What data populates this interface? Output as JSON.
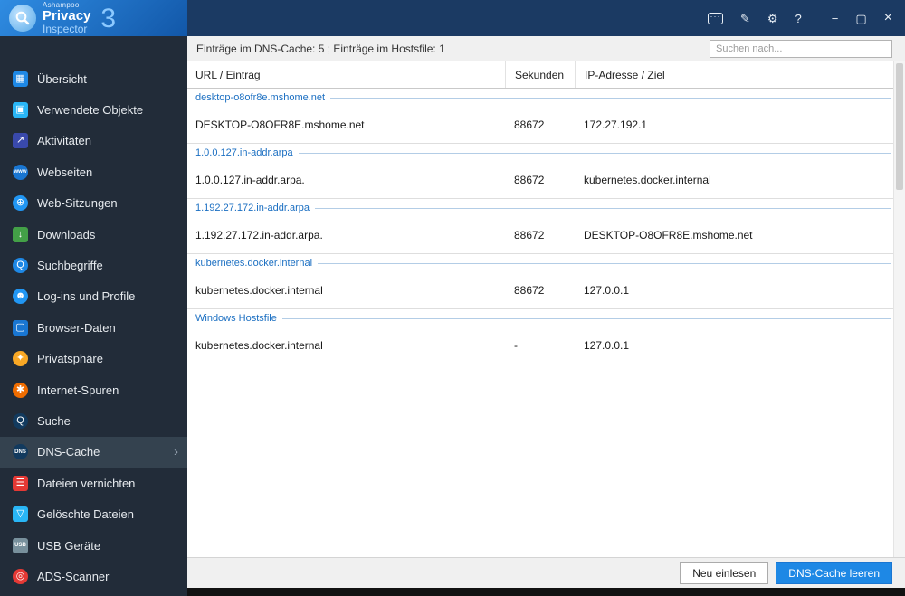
{
  "app": {
    "brand_small": "Ashampoo",
    "brand_line1": "Privacy",
    "brand_line2": "Inspector",
    "brand_version": "3"
  },
  "titlebar": {
    "icons": [
      {
        "name": "feedback-icon",
        "glyph": "···",
        "style": "bubble"
      },
      {
        "name": "survey-icon",
        "glyph": "✎"
      },
      {
        "name": "settings-icon",
        "glyph": "⚙"
      },
      {
        "name": "help-icon",
        "glyph": "?"
      },
      {
        "name": "minimize-icon",
        "glyph": "−",
        "win": true
      },
      {
        "name": "maximize-icon",
        "glyph": "▢",
        "win": false
      },
      {
        "name": "close-icon",
        "glyph": "×",
        "close": true
      }
    ]
  },
  "sidebar": {
    "items": [
      {
        "name": "uebersicht",
        "label": "Übersicht",
        "glyph": "▦",
        "bg": "#1e88e5",
        "shape": "square"
      },
      {
        "name": "verwendete-objekte",
        "label": "Verwendete Objekte",
        "glyph": "▣",
        "bg": "#29b6f6",
        "shape": "square"
      },
      {
        "name": "aktivitaeten",
        "label": "Aktivitäten",
        "glyph": "↗",
        "bg": "#3949ab",
        "shape": "square"
      },
      {
        "name": "webseiten",
        "label": "Webseiten",
        "glyph": "www",
        "bg": "#1976d2",
        "shape": "circle",
        "small": true
      },
      {
        "name": "web-sitzungen",
        "label": "Web-Sitzungen",
        "glyph": "⊕",
        "bg": "#2196f3",
        "shape": "circle"
      },
      {
        "name": "downloads",
        "label": "Downloads",
        "glyph": "↓",
        "bg": "#43a047",
        "shape": "square"
      },
      {
        "name": "suchbegriffe",
        "label": "Suchbegriffe",
        "glyph": "Q",
        "bg": "#1e88e5",
        "shape": "circle"
      },
      {
        "name": "logins-und-profile",
        "label": "Log-ins und Profile",
        "glyph": "☻",
        "bg": "#2196f3",
        "shape": "circle"
      },
      {
        "name": "browser-daten",
        "label": "Browser-Daten",
        "glyph": "▢",
        "bg": "#1976d2",
        "shape": "square"
      },
      {
        "name": "privatsphaere",
        "label": "Privatsphäre",
        "glyph": "✦",
        "bg": "#f9a825",
        "shape": "circle"
      },
      {
        "name": "internet-spuren",
        "label": "Internet-Spuren",
        "glyph": "✱",
        "bg": "#ef6c00",
        "shape": "circle"
      },
      {
        "name": "suche",
        "label": "Suche",
        "glyph": "Q",
        "bg": "#123a5e",
        "shape": "circle"
      },
      {
        "name": "dns-cache",
        "label": "DNS-Cache",
        "glyph": "DNS",
        "bg": "#123a5e",
        "shape": "circle",
        "small": true,
        "selected": true
      },
      {
        "name": "dateien-vernichten",
        "label": "Dateien vernichten",
        "glyph": "☰",
        "bg": "#e53935",
        "shape": "square"
      },
      {
        "name": "geloeschte-dateien",
        "label": "Gelöschte Dateien",
        "glyph": "▽",
        "bg": "#29b6f6",
        "shape": "square"
      },
      {
        "name": "usb-geraete",
        "label": "USB Geräte",
        "glyph": "USB",
        "bg": "#78909c",
        "shape": "square",
        "small": true
      },
      {
        "name": "ads-scanner",
        "label": "ADS-Scanner",
        "glyph": "◎",
        "bg": "#e53935",
        "shape": "circle"
      }
    ]
  },
  "main": {
    "status": "Einträge im DNS-Cache: 5 ; Einträge im Hostsfile: 1",
    "search_placeholder": "Suchen nach...",
    "table": {
      "columns": [
        "URL / Eintrag",
        "Sekunden",
        "IP-Adresse / Ziel"
      ],
      "groups": [
        {
          "header": "desktop-o8ofr8e.mshome.net",
          "rows": [
            [
              "DESKTOP-O8OFR8E.mshome.net",
              "88672",
              "172.27.192.1"
            ]
          ]
        },
        {
          "header": "1.0.0.127.in-addr.arpa",
          "rows": [
            [
              "1.0.0.127.in-addr.arpa.",
              "88672",
              "kubernetes.docker.internal"
            ]
          ]
        },
        {
          "header": "1.192.27.172.in-addr.arpa",
          "rows": [
            [
              "1.192.27.172.in-addr.arpa.",
              "88672",
              "DESKTOP-O8OFR8E.mshome.net"
            ]
          ]
        },
        {
          "header": "kubernetes.docker.internal",
          "rows": [
            [
              "kubernetes.docker.internal",
              "88672",
              "127.0.0.1"
            ]
          ]
        },
        {
          "header": "Windows Hostsfile",
          "rows": [
            [
              "kubernetes.docker.internal",
              "-",
              "127.0.0.1"
            ]
          ]
        }
      ]
    },
    "buttons": {
      "reload": "Neu einlesen",
      "clear": "DNS-Cache leeren"
    }
  },
  "colors": {
    "accent": "#1e88e5",
    "sidebar_bg": "#222c39",
    "titlebar_bg": "#1b3a63",
    "group_text": "#1b6fc2"
  }
}
